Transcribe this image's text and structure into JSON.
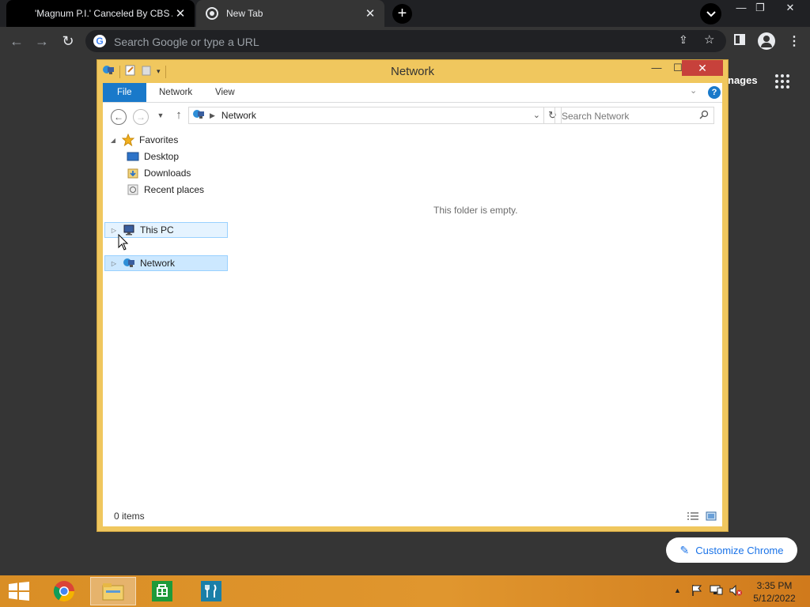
{
  "browser": {
    "tabs": [
      {
        "title": "'Magnum P.I.' Canceled By CBS A",
        "active": false
      },
      {
        "title": "New Tab",
        "active": true
      }
    ],
    "new_tab_label": "+",
    "omnibox": {
      "placeholder": "Search Google or type a URL"
    },
    "ntp": {
      "images_label": "nages",
      "customize_label": "Customize Chrome"
    },
    "icons": [
      "back-icon",
      "forward-icon",
      "reload-icon",
      "google-icon",
      "share-icon",
      "star-icon",
      "sidepanel-icon",
      "profile-icon",
      "menu-icon",
      "apps-grid-icon",
      "pencil-icon"
    ]
  },
  "explorer": {
    "title": "Network",
    "ribbon": {
      "file": "File",
      "network": "Network",
      "view": "View",
      "help": "?"
    },
    "address": {
      "crumb": "Network"
    },
    "search": {
      "placeholder": "Search Network"
    },
    "nav": {
      "favorites": "Favorites",
      "desktop": "Desktop",
      "downloads": "Downloads",
      "recent": "Recent places",
      "thispc": "This PC",
      "network": "Network"
    },
    "empty_message": "This folder is empty.",
    "status": {
      "item_count": "0 items"
    }
  },
  "taskbar": {
    "clock_time": "3:35 PM",
    "clock_date": "5/12/2022",
    "apps": [
      "chrome-icon",
      "file-explorer-icon",
      "store-icon",
      "restaurant-app-icon"
    ]
  },
  "colors": {
    "explorer_frame": "#f0c75e",
    "ribbon_file": "#1979ca",
    "close_button": "#c7413b",
    "chrome_dark": "#202124"
  }
}
